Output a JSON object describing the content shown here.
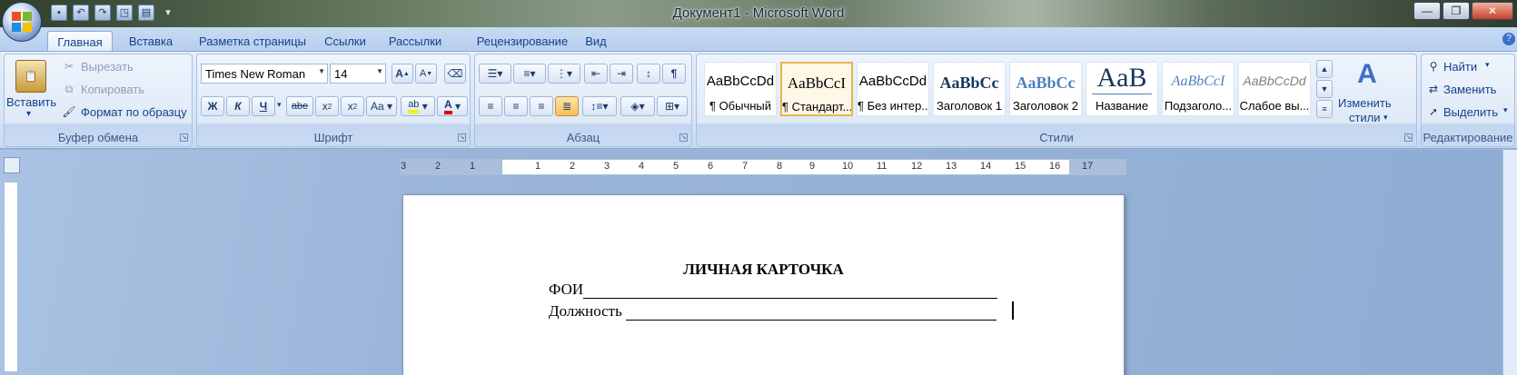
{
  "window": {
    "title": "Документ1 - Microsoft Word"
  },
  "qat": {
    "icons": [
      "save-icon",
      "undo-icon",
      "redo-icon",
      "print-preview-icon",
      "quick-print-icon",
      "customize-icon"
    ]
  },
  "tabs": [
    "Главная",
    "Вставка",
    "Разметка страницы",
    "Ссылки",
    "Рассылки",
    "Рецензирование",
    "Вид"
  ],
  "clipboard": {
    "label": "Буфер обмена",
    "paste": "Вставить",
    "cut": "Вырезать",
    "copy": "Копировать",
    "format_painter": "Формат по образцу"
  },
  "font": {
    "label": "Шрифт",
    "font_name": "Times New Roman",
    "font_size": "14",
    "grow": "A",
    "shrink": "A",
    "bold": "Ж",
    "italic": "К",
    "underline": "Ч",
    "strike": "abe",
    "subscript": "x",
    "superscript": "x",
    "case": "Aa",
    "highlight": "ab",
    "color": "A"
  },
  "paragraph": {
    "label": "Абзац"
  },
  "styles": {
    "label": "Стили",
    "items": [
      {
        "preview": "AaBbCcDd",
        "name": "¶ Обычный"
      },
      {
        "preview": "AaBbCcI",
        "name": "¶ Стандарт..."
      },
      {
        "preview": "AaBbCcDd",
        "name": "¶ Без интер..."
      },
      {
        "preview": "AaBbCc",
        "name": "Заголовок 1"
      },
      {
        "preview": "AaBbCc",
        "name": "Заголовок 2"
      },
      {
        "preview": "AaB",
        "name": "Название"
      },
      {
        "preview": "AaBbCcI",
        "name": "Подзаголо..."
      },
      {
        "preview": "AaBbCcDd",
        "name": "Слабое вы..."
      }
    ],
    "change_styles_1": "Изменить",
    "change_styles_2": "стили"
  },
  "editing": {
    "label": "Редактирование",
    "find": "Найти",
    "replace": "Заменить",
    "select": "Выделить"
  },
  "ruler": {
    "ticks": [
      "3",
      "2",
      "1",
      "1",
      "2",
      "3",
      "4",
      "5",
      "6",
      "7",
      "8",
      "9",
      "10",
      "11",
      "12",
      "13",
      "14",
      "15",
      "16",
      "17"
    ]
  },
  "document": {
    "title": "ЛИЧНАЯ КАРТОЧКА",
    "line1": "ФОИ",
    "line2": "Должность"
  }
}
